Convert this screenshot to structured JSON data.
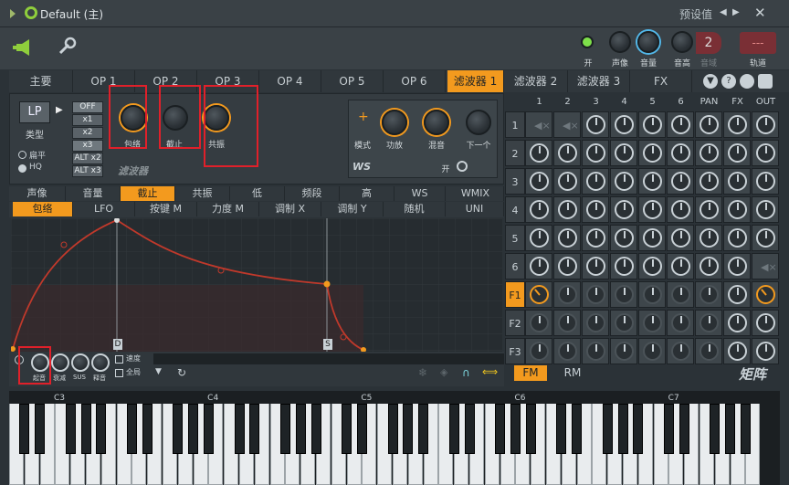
{
  "window": {
    "title": "Default (主)",
    "preset_label": "预设值"
  },
  "top": {
    "labels": [
      "开",
      "声像",
      "音量",
      "音高",
      "音域",
      "轨道"
    ],
    "pitch_value": "2",
    "track_value": "---"
  },
  "tabs": [
    "主要",
    "OP 1",
    "OP 2",
    "OP 3",
    "OP 4",
    "OP 5",
    "OP 6",
    "滤波器 1"
  ],
  "tabs_right": [
    "滤波器 2",
    "滤波器 3",
    "FX"
  ],
  "filter": {
    "type_value": "LP",
    "type_label": "类型",
    "mode_buttons": [
      "OFF",
      "x1",
      "x2",
      "x3",
      "ALT x2",
      "ALT x3"
    ],
    "radio_options": [
      "扁平",
      "HQ"
    ],
    "knobs": [
      "包络",
      "截止",
      "共振"
    ],
    "name": "滤波器",
    "ws_knobs": [
      "模式",
      "功放",
      "混音",
      "下一个"
    ],
    "ws_name": "WS",
    "ws_switch": "开"
  },
  "env_tabs": [
    "声像",
    "音量",
    "截止",
    "共振",
    "低",
    "频段",
    "高",
    "WS",
    "WMIX"
  ],
  "env_subtabs": [
    "包络",
    "LFO",
    "按键 M",
    "力度 M",
    "调制 X",
    "调制 Y",
    "随机",
    "UNI"
  ],
  "env_knobs": [
    "起音",
    "衰减",
    "SUS",
    "释音"
  ],
  "env_checks": [
    "速度",
    "全局"
  ],
  "env_markers": [
    "D",
    "S"
  ],
  "matrix": {
    "cols": [
      "1",
      "2",
      "3",
      "4",
      "5",
      "6",
      "PAN",
      "FX",
      "OUT"
    ],
    "rows": [
      "1",
      "2",
      "3",
      "4",
      "5",
      "6",
      "F1",
      "F2",
      "F3"
    ],
    "bottom_tabs": [
      "FM",
      "RM"
    ],
    "title": "矩阵"
  },
  "keyboard": {
    "octaves": [
      "C3",
      "C4",
      "C5",
      "C6",
      "C7"
    ]
  },
  "colors": {
    "accent": "#f39a1e",
    "highlight_box": "#e0202a",
    "background": "#2b3237"
  }
}
